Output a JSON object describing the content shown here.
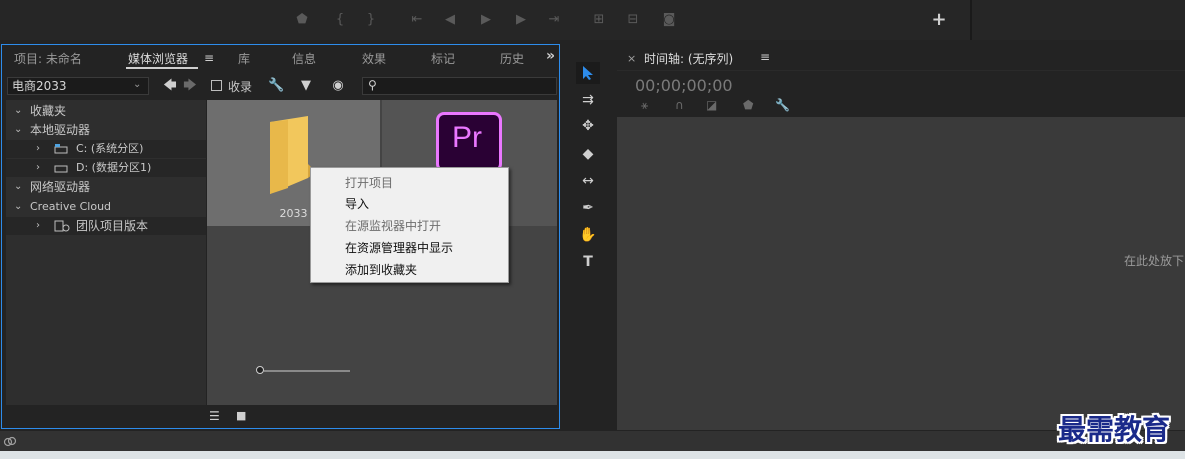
{
  "colors": {
    "panel_focus_border": "#2d8ceb",
    "selection_arrow": "#2d8ceb",
    "pr_logo_bg": "#2a0134",
    "pr_logo_fg": "#ea77ff",
    "folder": "#f2c75c",
    "watermark": "#1a2a8a"
  },
  "top_transport": {
    "icons": [
      "marker-icon",
      "in-point-icon",
      "out-point-icon",
      "go-to-in-icon",
      "step-back-icon",
      "play-icon",
      "step-forward-icon",
      "go-to-out-icon",
      "insert-icon",
      "overwrite-icon",
      "export-frame-icon"
    ],
    "add_button": "+"
  },
  "left_panel": {
    "tabs": [
      {
        "label": "项目: 未命名",
        "active": false
      },
      {
        "label": "媒体浏览器",
        "active": true
      },
      {
        "label": "库",
        "active": false
      },
      {
        "label": "信息",
        "active": false
      },
      {
        "label": "效果",
        "active": false
      },
      {
        "label": "标记",
        "active": false
      },
      {
        "label": "历史",
        "active": false
      }
    ],
    "menu_icon": "≡",
    "more_icon": "»",
    "location_dropdown": "电商2033",
    "ingest_label": "收录",
    "search_placeholder": "",
    "tree": [
      {
        "label": "收藏夹",
        "expanded": true
      },
      {
        "label": "本地驱动器",
        "expanded": true
      },
      {
        "label": "C: (系统分区)",
        "expanded": false
      },
      {
        "label": "D: (数据分区1)",
        "expanded": false
      },
      {
        "label": "网络驱动器",
        "expanded": true
      },
      {
        "label": "Creative Cloud",
        "expanded": true
      },
      {
        "label": "团队项目版本",
        "expanded": false
      }
    ],
    "grid": {
      "folder_label": "2033",
      "pr_logo_text": "Pr"
    }
  },
  "context_menu": {
    "items": [
      {
        "label": "打开项目",
        "enabled": false
      },
      {
        "label": "导入",
        "enabled": true
      },
      {
        "label": "在源监视器中打开",
        "enabled": false
      },
      {
        "label": "在资源管理器中显示",
        "enabled": true
      },
      {
        "label": "添加到收藏夹",
        "enabled": true
      }
    ]
  },
  "timeline": {
    "close": "×",
    "title": "时间轴: (无序列)",
    "menu": "≡",
    "timecode": "00;00;00;00",
    "drop_hint": "在此处放下"
  },
  "watermark": "最需教育"
}
